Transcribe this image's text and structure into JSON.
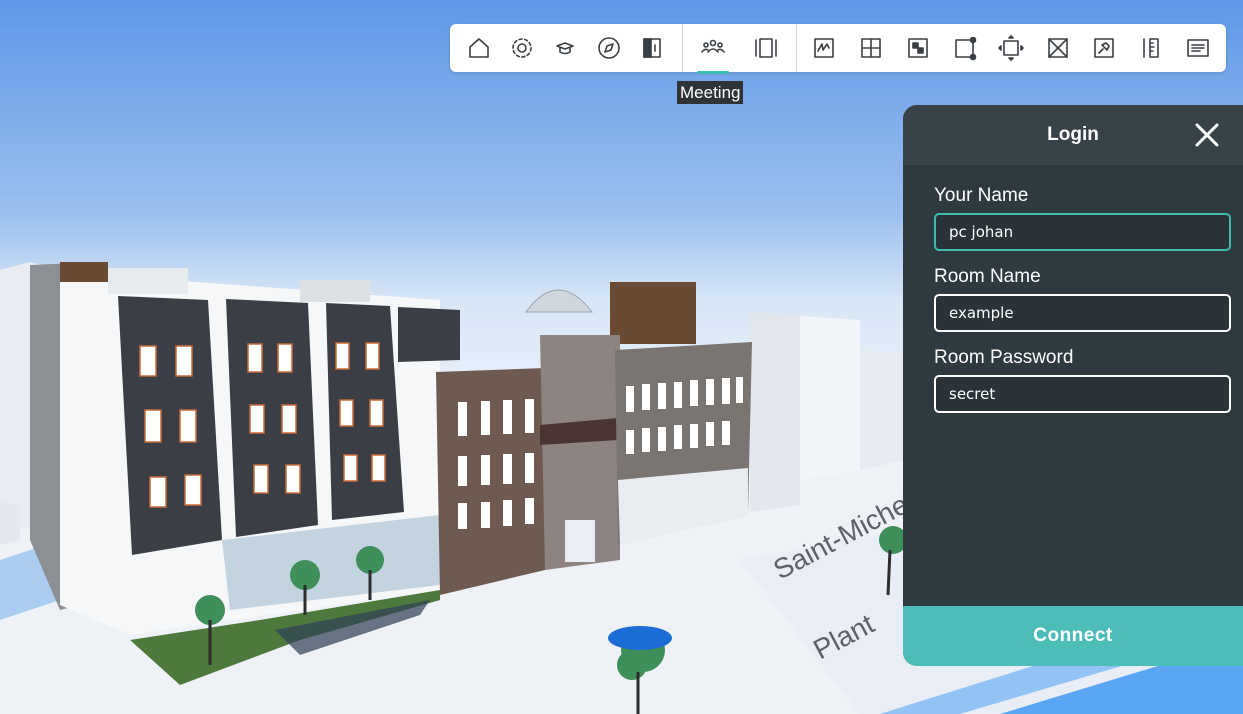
{
  "toolbar": {
    "buttons": [
      {
        "icon": "home-icon"
      },
      {
        "icon": "settings-gear-icon"
      },
      {
        "icon": "graduation-cap-icon"
      },
      {
        "icon": "compass-icon"
      },
      {
        "icon": "split-view-icon"
      },
      {
        "icon": "meeting-people-icon",
        "active": true
      },
      {
        "icon": "slides-panel-icon"
      },
      {
        "icon": "sketch-box-icon"
      },
      {
        "icon": "section-grid-icon"
      },
      {
        "icon": "checker-box-icon"
      },
      {
        "icon": "node-edit-icon"
      },
      {
        "icon": "fit-extent-icon"
      },
      {
        "icon": "box-cross-icon"
      },
      {
        "icon": "pin-icon"
      },
      {
        "icon": "measure-ruler-icon"
      },
      {
        "icon": "notes-list-icon"
      }
    ],
    "accent_color": "#3dbdb0",
    "tooltip": "Meeting"
  },
  "login": {
    "title": "Login",
    "name_label": "Your Name",
    "name_value": "pc johan",
    "room_label": "Room Name",
    "room_value": "example",
    "password_label": "Room Password",
    "password_value": "secret",
    "connect_label": "Connect",
    "panel_color": "#2e3a40",
    "connect_color": "#4dbdb7"
  },
  "scene": {
    "street_label_1": "Saint-Michel",
    "street_label_2": "Plant"
  }
}
